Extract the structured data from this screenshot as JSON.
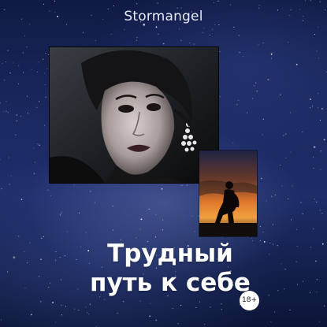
{
  "cover": {
    "author": "Stormangel",
    "title_line1": "Трудный",
    "title_line2": "путь к себе",
    "age_rating": "18+"
  },
  "colors": {
    "background": "#1b2a63",
    "title_text": "#ffffff",
    "badge_bg": "#ffffff",
    "sky_orange": "#e0782a"
  },
  "images": {
    "portrait": "woman-portrait-dark-makeup-earring",
    "silhouette": "kneeling-figure-silhouette-sunset"
  }
}
